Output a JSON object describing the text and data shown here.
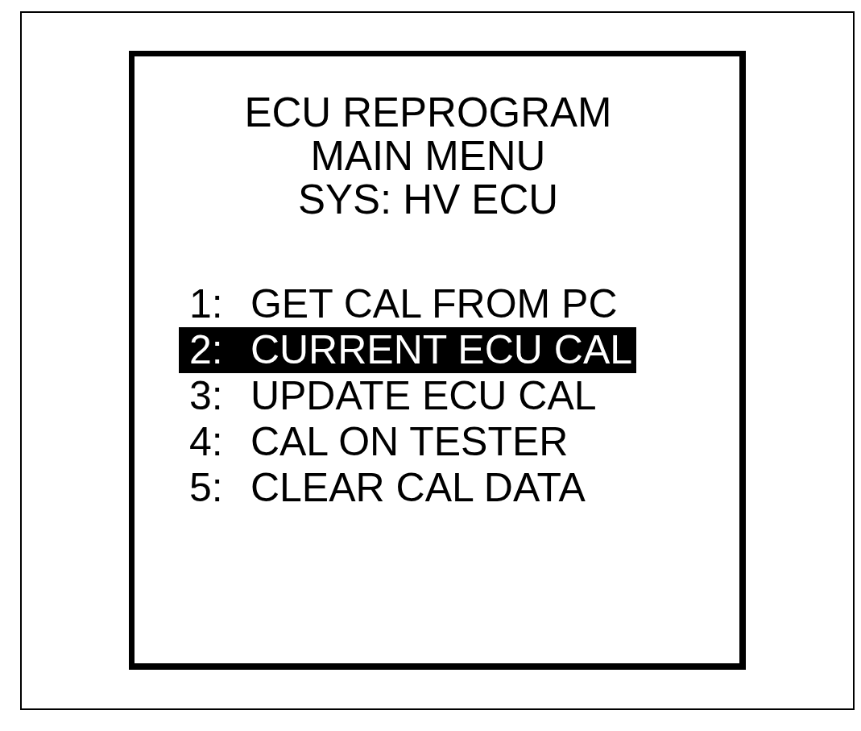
{
  "screen": {
    "title_lines": [
      "ECU REPROGRAM",
      "MAIN MENU",
      "SYS: HV ECU"
    ],
    "menu_items": [
      {
        "number": "1:",
        "label": "GET CAL FROM PC",
        "selected": false
      },
      {
        "number": "2:",
        "label": "CURRENT ECU CAL",
        "selected": true
      },
      {
        "number": "3:",
        "label": "UPDATE ECU CAL",
        "selected": false
      },
      {
        "number": "4:",
        "label": "CAL ON TESTER",
        "selected": false
      },
      {
        "number": "5:",
        "label": "CLEAR CAL DATA",
        "selected": false
      }
    ]
  }
}
